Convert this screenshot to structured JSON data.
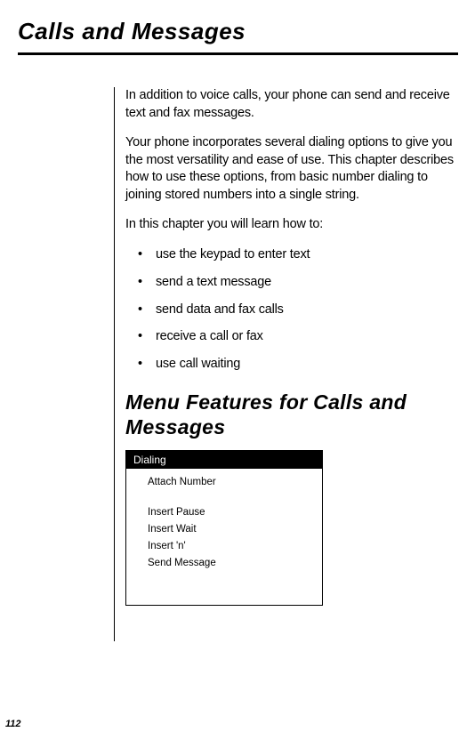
{
  "title": "Calls and Messages",
  "intro": {
    "p1": "In addition to voice calls, your phone can send and receive text and fax messages.",
    "p2": "Your phone incorporates several dialing options to give you the most versatility and ease of use. This chapter describes how to use these options, from basic number dialing to joining stored numbers into a single string.",
    "p3": "In this chapter you will learn how to:"
  },
  "bullets": [
    "use the keypad to enter text",
    "send a text message",
    "send data and fax calls",
    "receive a call or fax",
    "use call waiting"
  ],
  "section_heading": "Menu Features for Calls and Messages",
  "menu": {
    "header": "Dialing",
    "items": [
      "Attach Number",
      "Insert Pause",
      "Insert Wait",
      "Insert 'n'",
      "Send Message"
    ]
  },
  "page_number": "112"
}
